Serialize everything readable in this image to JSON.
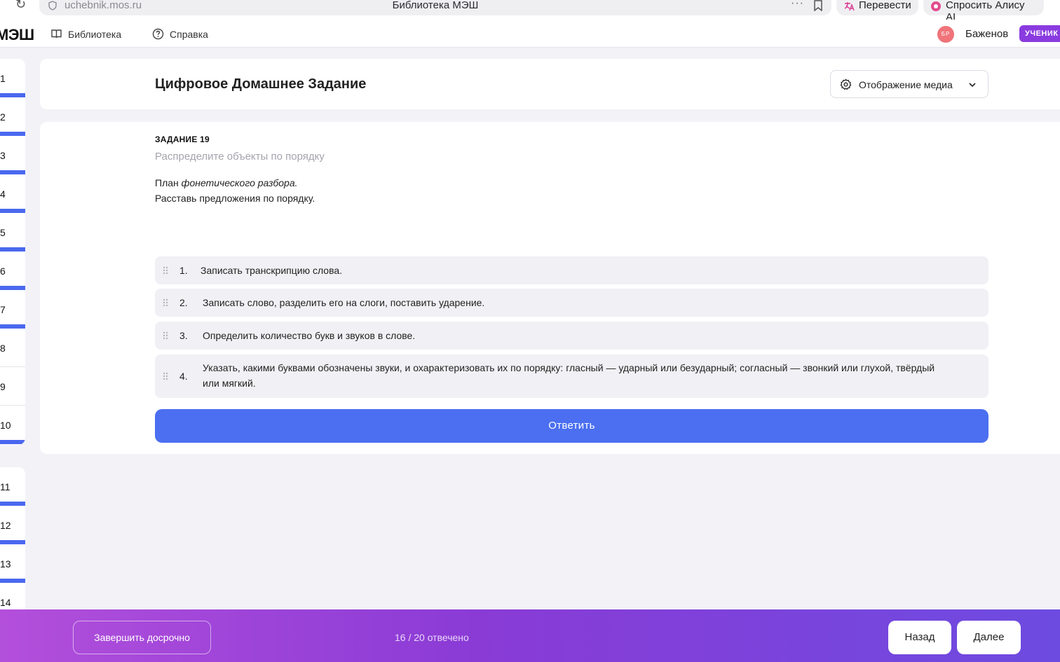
{
  "browser": {
    "url": "uchebnik.mos.ru",
    "page_title": "Библиотека МЭШ",
    "dots": "···",
    "translate_label": "Перевести",
    "alice_label": "Спросить Алису AI"
  },
  "header": {
    "logo": "МЭШ",
    "nav": {
      "library": "Библиотека",
      "help": "Справка"
    },
    "avatar_initials": "БР",
    "username": "Баженов",
    "role": "УЧЕНИК"
  },
  "sidebar": {
    "group1": [
      {
        "n": "1",
        "done": true
      },
      {
        "n": "2",
        "done": true
      },
      {
        "n": "3",
        "done": true
      },
      {
        "n": "4",
        "done": true
      },
      {
        "n": "5",
        "done": true
      },
      {
        "n": "6",
        "done": true
      },
      {
        "n": "7",
        "done": true
      },
      {
        "n": "8",
        "done": false
      },
      {
        "n": "9",
        "done": false
      },
      {
        "n": "10",
        "done": true
      }
    ],
    "group2": [
      {
        "n": "11",
        "done": true
      },
      {
        "n": "12",
        "done": true
      },
      {
        "n": "13",
        "done": true
      },
      {
        "n": "14",
        "done": false
      }
    ]
  },
  "main": {
    "title": "Цифровое Домашнее Задание",
    "media_button": "Отображение медиа",
    "task": {
      "number": "ЗАДАНИЕ 19",
      "type": "Распределите объекты по порядку",
      "text_prefix": "План ",
      "text_italic": "фонетического разбора.",
      "text_line2": "Расставь предложения по порядку.",
      "items": [
        {
          "num": "1.",
          "text": "Записать транскрипцию слова."
        },
        {
          "num": "2.",
          "text": "Записать слово, разделить его на слоги, поставить ударение."
        },
        {
          "num": "3.",
          "text": "Определить количество букв и звуков в слове."
        },
        {
          "num": "4.",
          "text": "Указать, какими буквами обозначены звуки, и охарактеризовать их по порядку: гласный — ударный или безударный; согласный — звонкий или глухой, твёрдый или мягкий."
        }
      ],
      "answer_button": "Ответить"
    }
  },
  "footer": {
    "finish_button": "Завершить досрочно",
    "progress": "16 / 20 отвечено",
    "back_button": "Назад",
    "next_button": "Далее"
  },
  "colors": {
    "accent": "#4b6ff0",
    "done_marker": "#4a68ef",
    "role_badge": "#8a3be0",
    "footer_gradient": [
      "#b34fdb",
      "#8a3bd6",
      "#6d4be0"
    ]
  }
}
